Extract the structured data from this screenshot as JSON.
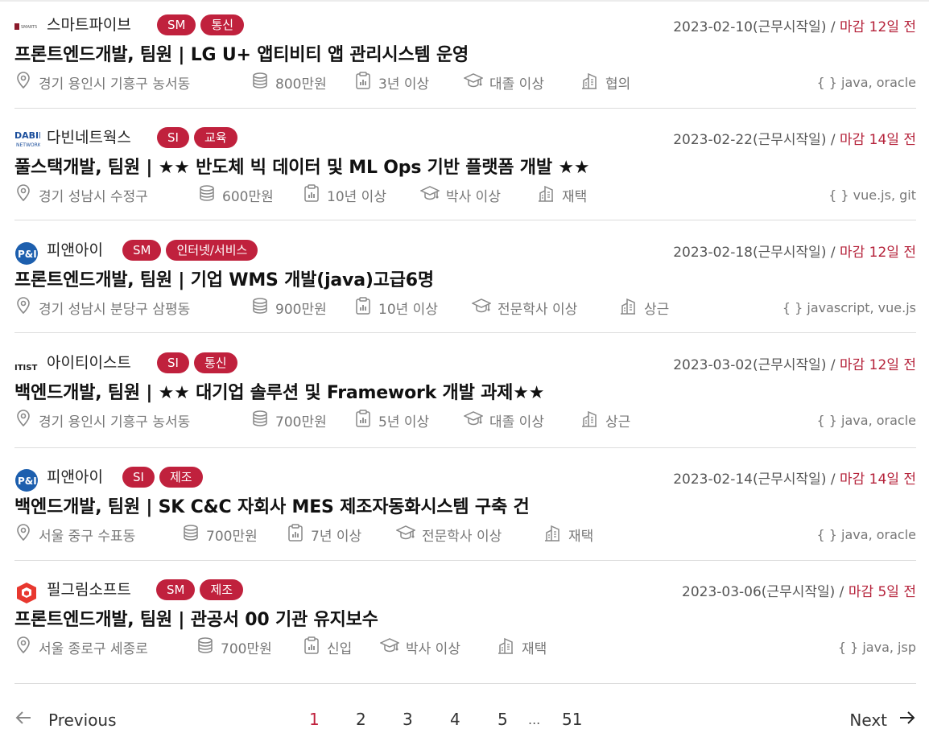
{
  "jobs": [
    {
      "company": "스마트파이브",
      "logo": "smart5-logo",
      "tags": [
        "SM",
        "통신"
      ],
      "date": "2023-02-10(근무시작일)",
      "deadline": "마감 12일 전",
      "title": "프론트엔드개발, 팀원 | LG U+ 앱티비티 앱 관리시스템 운영",
      "location": "경기 용인시 기흥구 농서동",
      "salary": "800만원",
      "experience": "3년 이상",
      "education": "대졸 이상",
      "work_type": "협의",
      "skills": "{ } java, oracle"
    },
    {
      "company": "다빈네트웍스",
      "logo": "dabin-logo",
      "tags": [
        "SI",
        "교육"
      ],
      "date": "2023-02-22(근무시작일)",
      "deadline": "마감 14일 전",
      "title": "풀스택개발, 팀원 | ★★ 반도체 빅 데이터 및 ML Ops 기반 플랫폼 개발 ★★",
      "location": "경기 성남시 수정구",
      "salary": "600만원",
      "experience": "10년 이상",
      "education": "박사 이상",
      "work_type": "재택",
      "skills": "{ } vue.js, git"
    },
    {
      "company": "피앤아이",
      "logo": "pni-logo",
      "tags": [
        "SM",
        "인터넷/서비스"
      ],
      "date": "2023-02-18(근무시작일)",
      "deadline": "마감 12일 전",
      "title": "프론트엔드개발, 팀원 | 기업 WMS 개발(java)고급6명",
      "location": "경기 성남시 분당구 삼평동",
      "salary": "900만원",
      "experience": "10년 이상",
      "education": "전문학사 이상",
      "work_type": "상근",
      "skills": "{ } javascript, vue.js"
    },
    {
      "company": "아이티이스트",
      "logo": "itist-logo",
      "tags": [
        "SI",
        "통신"
      ],
      "date": "2023-03-02(근무시작일)",
      "deadline": "마감 12일 전",
      "title": "백엔드개발, 팀원 | ★★ 대기업 솔루션 및 Framework 개발 과제★★",
      "location": "경기 용인시 기흥구 농서동",
      "salary": "700만원",
      "experience": "5년 이상",
      "education": "대졸 이상",
      "work_type": "상근",
      "skills": "{ } java, oracle"
    },
    {
      "company": "피앤아이",
      "logo": "pni-logo",
      "tags": [
        "SI",
        "제조"
      ],
      "date": "2023-02-14(근무시작일)",
      "deadline": "마감 14일 전",
      "title": "백엔드개발, 팀원 | SK C&C 자회사 MES 제조자동화시스템 구축 건",
      "location": "서울 중구 수표동",
      "salary": "700만원",
      "experience": "7년 이상",
      "education": "전문학사 이상",
      "work_type": "재택",
      "skills": "{ } java, oracle"
    },
    {
      "company": "필그림소프트",
      "logo": "pilgrim-logo",
      "tags": [
        "SM",
        "제조"
      ],
      "date": "2023-03-06(근무시작일)",
      "deadline": "마감 5일 전",
      "title": "프론트엔드개발, 팀원 | 관공서 00 기관 유지보수",
      "location": "서울 종로구 세종로",
      "salary": "700만원",
      "experience": "신입",
      "education": "박사 이상",
      "work_type": "재택",
      "skills": "{ } java, jsp"
    }
  ],
  "date_separator": "/",
  "pagination": {
    "previous": "Previous",
    "next": "Next",
    "pages": [
      "1",
      "2",
      "3",
      "4",
      "5"
    ],
    "ellipsis": "...",
    "last": "51",
    "active": "1"
  },
  "colors": {
    "accent": "#c0213d",
    "deadline": "#b5223a",
    "muted": "#777777"
  }
}
